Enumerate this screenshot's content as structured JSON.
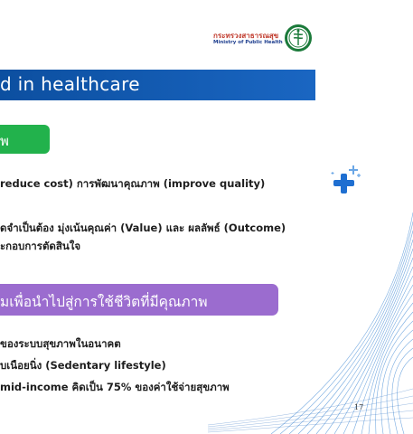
{
  "logo": {
    "org_thai": "กระทรวงสาธารณสุข",
    "org_en": "Ministry of Public Health",
    "seal_icon": "mph-seal-icon"
  },
  "title": "d in healthcare",
  "green_tag": "พ",
  "bullets": {
    "line1": "reduce cost) การพัฒนาคุณภาพ (improve quality)",
    "line2": "ดจำเป็นต้อง มุ่งเน้นคุณค่า (Value) และ ผลลัพธ์ (Outcome)",
    "line3": "ะกอบการตัดสินใจ"
  },
  "purple_banner": "มเพื่อนำไปสู่การใช้ชีวิตที่มีคุณภาพ",
  "bullets2": {
    "line4": "ของระบบสุขภาพในอนาคต",
    "line5": "บเนือยนิ่ง (Sedentary lifestyle)",
    "line6": "mid-income คิดเป็น 75% ของค่าใช้จ่ายสุขภาพ"
  },
  "decor": {
    "plus_icon": "plus-sparkle-icon",
    "accent_color": "#1f6fd1"
  },
  "page_number": "17"
}
